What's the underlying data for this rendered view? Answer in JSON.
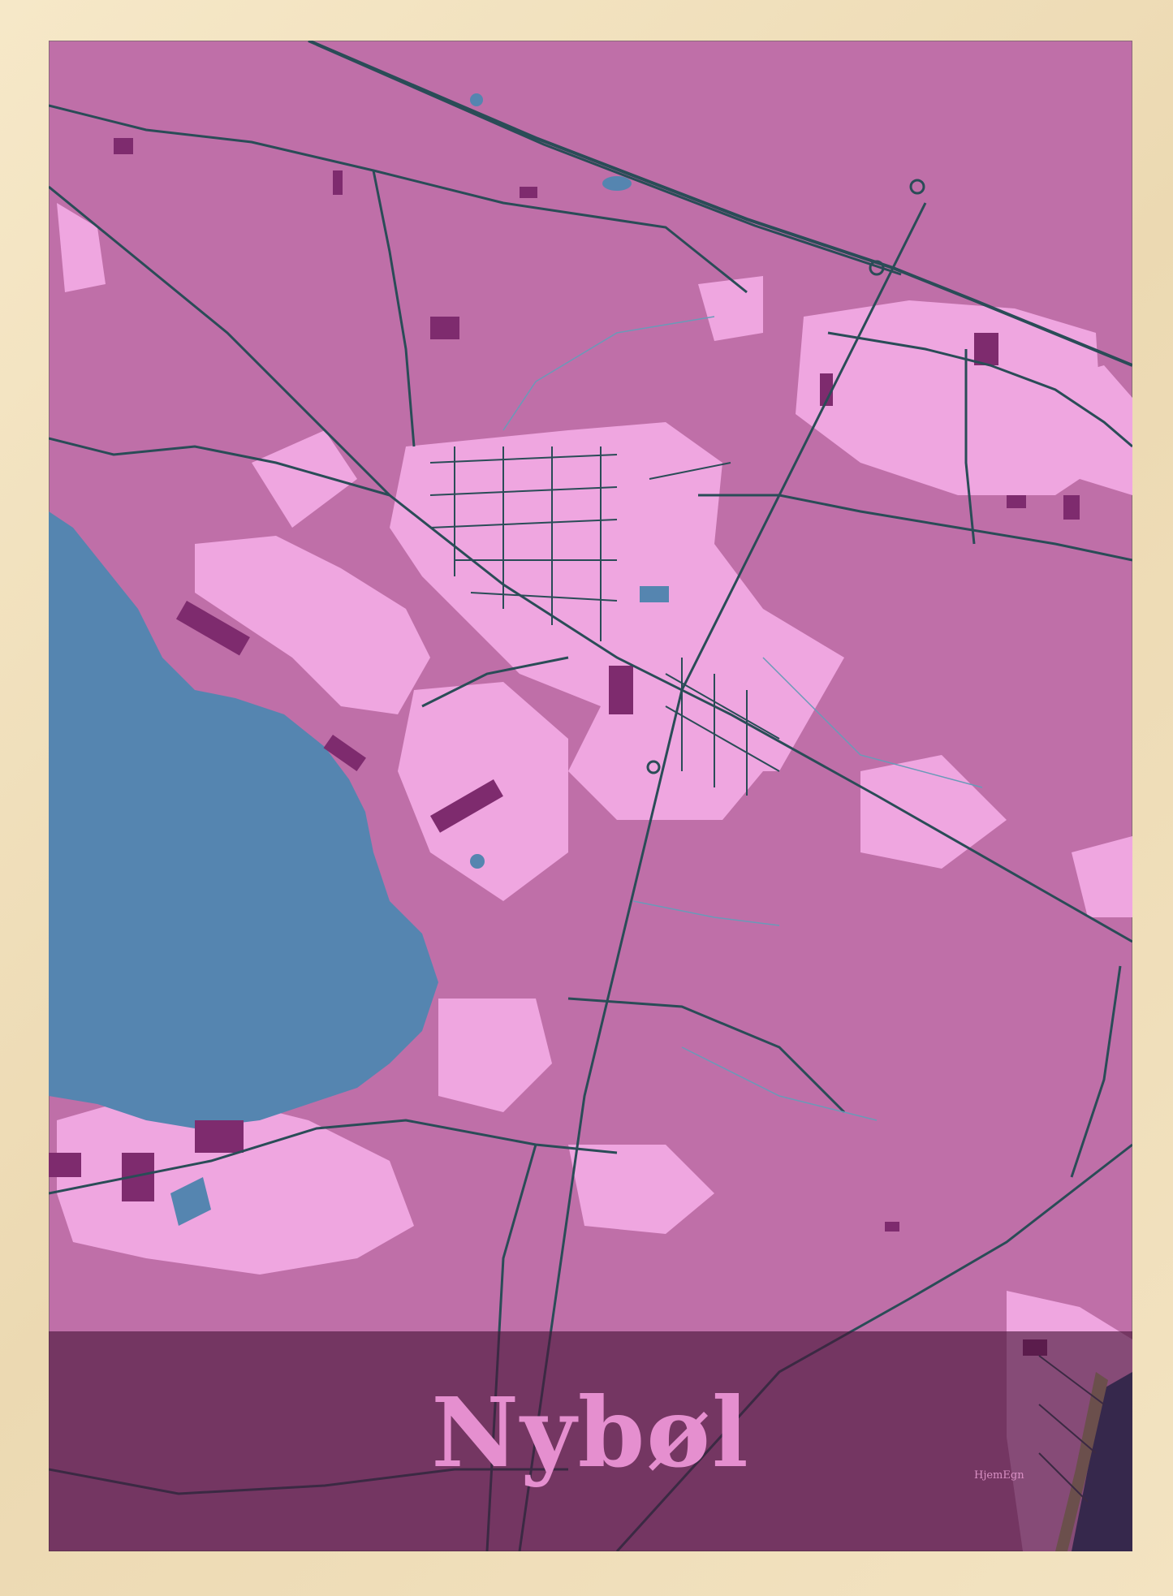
{
  "poster": {
    "title": "Nybøl",
    "brand": "HjemEgn"
  },
  "colors": {
    "frame": "#efe0bf",
    "land": "#bf6fa8",
    "built_area": "#efa6e0",
    "buildings": "#7e2b6e",
    "water": "#5585b0",
    "roads": "#2a4c57",
    "title_band": "#5c2d4f",
    "title_text": "#e58fcf"
  },
  "icons": {
    "water": "lake",
    "roads": "road-network",
    "buildings": "building-blocks"
  }
}
